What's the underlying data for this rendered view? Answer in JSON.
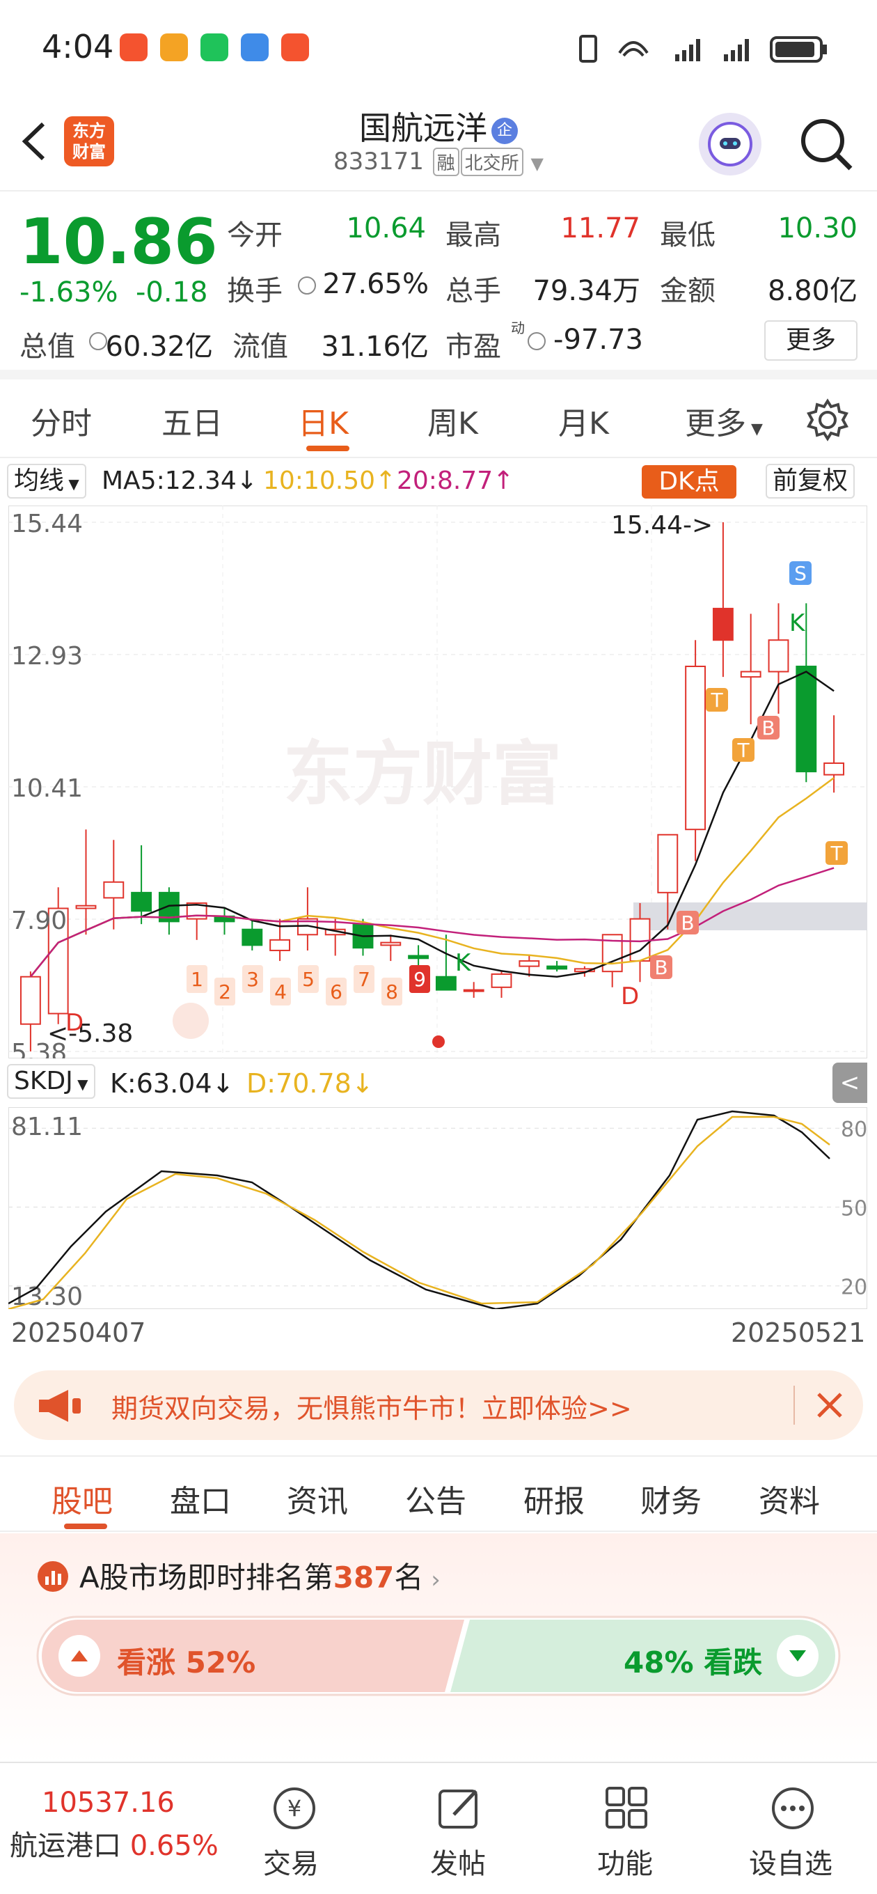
{
  "status_bar": {
    "time": "4:04"
  },
  "header": {
    "title": "国航远洋",
    "badge": "企",
    "code": "833171",
    "tag_margin": "融",
    "exchange": "北交所",
    "logo_line1": "东方",
    "logo_line2": "财富"
  },
  "quote": {
    "price": "10.86",
    "change_pct": "-1.63%",
    "change_abs": "-0.18",
    "fields": [
      {
        "label": "今开",
        "value": "10.64",
        "color": "#0a9b2e"
      },
      {
        "label": "最高",
        "value": "11.77",
        "color": "#e0332b"
      },
      {
        "label": "最低",
        "value": "10.30",
        "color": "#0a9b2e"
      },
      {
        "label": "换手",
        "value": "27.65%",
        "color": "#222222"
      },
      {
        "label": "总手",
        "value": "79.34万",
        "color": "#222222"
      },
      {
        "label": "金额",
        "value": "8.80亿",
        "color": "#222222"
      },
      {
        "label": "总值",
        "value": "60.32亿",
        "color": "#222222"
      },
      {
        "label": "流值",
        "value": "31.16亿",
        "color": "#222222"
      },
      {
        "label": "市盈",
        "value": "-97.73",
        "color": "#222222"
      }
    ],
    "pe_sup": "动",
    "more_label": "更多"
  },
  "period_tabs": [
    "分时",
    "五日",
    "日K",
    "周K",
    "月K",
    "更多"
  ],
  "period_active": 2,
  "ma": {
    "selector": "均线",
    "ma5": "MA5:12.34↓",
    "ma10": "10:10.50↑",
    "ma20": "20:8.77↑",
    "dk_label": "DK点",
    "adjust_label": "前复权"
  },
  "chart_labels": {
    "y_ticks": [
      "15.44",
      "12.93",
      "10.41",
      "7.90",
      "5.38"
    ],
    "max_marker": "15.44->",
    "min_marker": "<-5.38",
    "watermark": "东方财富",
    "seq_numbers": [
      "1",
      "2",
      "3",
      "4",
      "5",
      "6",
      "7",
      "8",
      "9"
    ],
    "d_label": "D",
    "k_label": "K",
    "b_label": "B",
    "t_label": "T",
    "s_label": "S"
  },
  "skdj": {
    "name": "SKDJ",
    "k": "K:63.04↓",
    "d": "D:70.78↓",
    "top_val": "81.11",
    "bottom_val": "13.30",
    "levels": [
      "80",
      "50",
      "20"
    ],
    "date_start": "20250407",
    "date_end": "20250521"
  },
  "chart_data": {
    "type": "candlestick",
    "x_range": [
      "20250407",
      "20250521"
    ],
    "ylim": [
      5.38,
      15.44
    ],
    "candles": [
      {
        "o": 5.9,
        "h": 6.9,
        "l": 5.38,
        "c": 6.8
      },
      {
        "o": 6.1,
        "h": 8.5,
        "l": 5.9,
        "c": 8.1
      },
      {
        "o": 8.1,
        "h": 9.6,
        "l": 7.6,
        "c": 8.15
      },
      {
        "o": 8.3,
        "h": 9.4,
        "l": 7.7,
        "c": 8.6
      },
      {
        "o": 8.4,
        "h": 9.3,
        "l": 7.8,
        "c": 8.05
      },
      {
        "o": 8.4,
        "h": 8.5,
        "l": 7.6,
        "c": 7.85
      },
      {
        "o": 7.9,
        "h": 8.1,
        "l": 7.5,
        "c": 8.2
      },
      {
        "o": 7.95,
        "h": 8.1,
        "l": 7.6,
        "c": 7.85
      },
      {
        "o": 7.7,
        "h": 7.9,
        "l": 7.3,
        "c": 7.4
      },
      {
        "o": 7.3,
        "h": 7.9,
        "l": 7.1,
        "c": 7.5
      },
      {
        "o": 7.6,
        "h": 8.5,
        "l": 7.3,
        "c": 7.9
      },
      {
        "o": 7.6,
        "h": 7.9,
        "l": 7.2,
        "c": 7.7
      },
      {
        "o": 7.8,
        "h": 7.9,
        "l": 7.2,
        "c": 7.35
      },
      {
        "o": 7.4,
        "h": 7.6,
        "l": 7.1,
        "c": 7.45
      },
      {
        "o": 7.2,
        "h": 7.4,
        "l": 7.0,
        "c": 7.15
      },
      {
        "o": 6.8,
        "h": 7.6,
        "l": 6.6,
        "c": 6.55
      },
      {
        "o": 6.55,
        "h": 6.7,
        "l": 6.4,
        "c": 6.55
      },
      {
        "o": 6.6,
        "h": 6.9,
        "l": 6.4,
        "c": 6.85
      },
      {
        "o": 7.0,
        "h": 7.2,
        "l": 6.8,
        "c": 7.1
      },
      {
        "o": 7.0,
        "h": 7.1,
        "l": 6.9,
        "c": 6.95
      },
      {
        "o": 6.9,
        "h": 7.0,
        "l": 6.8,
        "c": 6.95
      },
      {
        "o": 6.9,
        "h": 7.2,
        "l": 6.6,
        "c": 7.6
      },
      {
        "o": 7.1,
        "h": 8.2,
        "l": 6.7,
        "c": 7.9
      },
      {
        "o": 8.4,
        "h": 9.1,
        "l": 7.7,
        "c": 9.5
      },
      {
        "o": 9.6,
        "h": 13.2,
        "l": 9.0,
        "c": 12.7
      },
      {
        "o": 13.2,
        "h": 15.44,
        "l": 12.5,
        "c": 13.8
      },
      {
        "o": 12.5,
        "h": 13.7,
        "l": 11.6,
        "c": 12.6
      },
      {
        "o": 12.6,
        "h": 13.9,
        "l": 11.8,
        "c": 13.2
      },
      {
        "o": 12.7,
        "h": 13.9,
        "l": 10.5,
        "c": 10.7
      },
      {
        "o": 10.64,
        "h": 11.77,
        "l": 10.3,
        "c": 10.86
      }
    ]
  },
  "promo": {
    "text": "期货双向交易，无惧熊市牛市！立即体验>>"
  },
  "content_tabs": [
    "股吧",
    "盘口",
    "资讯",
    "公告",
    "研报",
    "财务",
    "资料"
  ],
  "rank": {
    "prefix": "A股市场即时排名第",
    "num": "387",
    "suffix": "名"
  },
  "sentiment": {
    "up_label": "看涨 52%",
    "down_label": "48% 看跌",
    "up": 0.52,
    "down": 0.48
  },
  "bottom_nav": {
    "index_value": "10537.16",
    "index_name": "航运港口",
    "index_change": "0.65%",
    "items": [
      "交易",
      "发帖",
      "功能",
      "设自选"
    ]
  },
  "colors": {
    "up": "#e0332b",
    "down": "#0a9b2e",
    "accent": "#e85d1a",
    "ma10": "#e8b320",
    "ma20": "#c2207a"
  }
}
